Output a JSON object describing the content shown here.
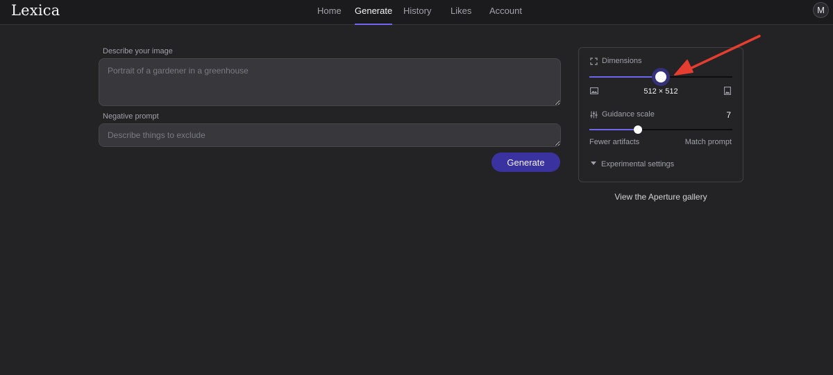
{
  "app": {
    "logo": "Lexica"
  },
  "nav": {
    "items": [
      {
        "label": "Home",
        "active": false
      },
      {
        "label": "Generate",
        "active": true
      },
      {
        "label": "History",
        "active": false
      },
      {
        "label": "Likes",
        "active": false
      },
      {
        "label": "Account",
        "active": false
      }
    ],
    "avatar_initial": "M"
  },
  "prompt": {
    "label": "Describe your image",
    "placeholder": "Portrait of a gardener in a greenhouse",
    "value": ""
  },
  "negative": {
    "label": "Negative prompt",
    "placeholder": "Describe things to exclude",
    "value": ""
  },
  "generate_button": {
    "label": "Generate"
  },
  "settings": {
    "dimensions": {
      "label": "Dimensions",
      "value_text": "512 × 512",
      "slider_fraction": 0.5,
      "left_icon": "landscape-image-icon",
      "right_icon": "portrait-image-icon",
      "icon": "expand-corners-icon"
    },
    "guidance": {
      "label": "Guidance scale",
      "value": "7",
      "slider_fraction": 0.34,
      "left_hint": "Fewer artifacts",
      "right_hint": "Match prompt",
      "icon": "sliders-icon"
    },
    "experimental": {
      "label": "Experimental settings",
      "icon": "caret-down-icon"
    }
  },
  "gallery_link": {
    "label": "View the Aperture gallery"
  },
  "colors": {
    "accent": "#6d66f0",
    "button": "#3a329e",
    "annotation_arrow": "#e53e30"
  }
}
